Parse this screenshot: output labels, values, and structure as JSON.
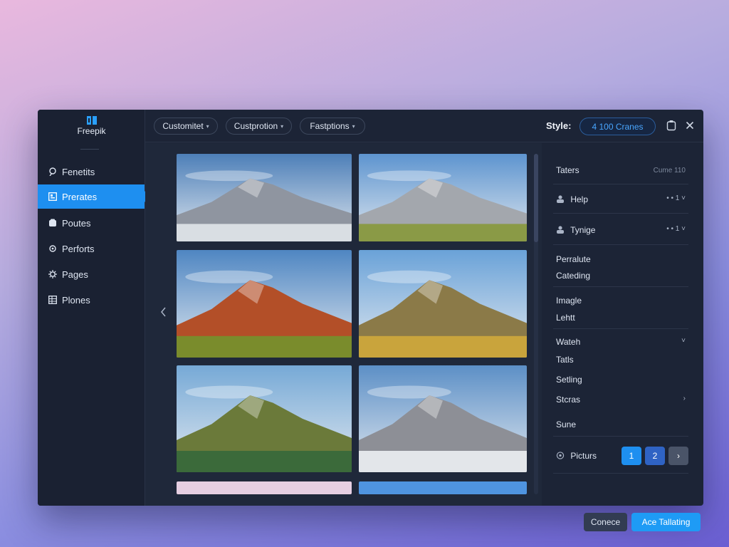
{
  "brand": {
    "name": "Freepik"
  },
  "sidebar": {
    "items": [
      {
        "label": "Fenetits",
        "icon": "search-user-icon"
      },
      {
        "label": "Prerates",
        "icon": "gallery-icon",
        "active": true
      },
      {
        "label": "Poutes",
        "icon": "tag-icon"
      },
      {
        "label": "Perforts",
        "icon": "gear-icon"
      },
      {
        "label": "Pages",
        "icon": "settings-cog-icon"
      },
      {
        "label": "Plones",
        "icon": "grid-table-icon"
      }
    ]
  },
  "toolbar": {
    "filters": [
      "Customitet",
      "Custprotion",
      "Fastptions"
    ],
    "style_label": "Style:",
    "credits": "4 100 Cranes"
  },
  "gallery": {
    "images": [
      {
        "name": "snow-mountain-sunset",
        "sky": "#4d7fb8",
        "rock": "#8f95a0",
        "ground": "#d9dee3"
      },
      {
        "name": "snow-mountain-meadow",
        "sky": "#5d94cf",
        "rock": "#a3a7ad",
        "ground": "#8a9a46"
      },
      {
        "name": "red-rock-hill",
        "sky": "#4f86c2",
        "rock": "#b34f28",
        "ground": "#7a8c2c"
      },
      {
        "name": "mesa-grassland",
        "sky": "#6aa2d8",
        "rock": "#8b7a48",
        "ground": "#c9a43c"
      },
      {
        "name": "green-peak",
        "sky": "#76a9d6",
        "rock": "#6b7a3a",
        "ground": "#3b6a3a"
      },
      {
        "name": "rocky-summit",
        "sky": "#5c8fc6",
        "rock": "#8d8f96",
        "ground": "#e3e6ea"
      }
    ]
  },
  "panel": {
    "header": {
      "title": "Taters",
      "meta": "Cume 110"
    },
    "rows": [
      {
        "label": "Help",
        "value": "• • 1 ˅"
      },
      {
        "label": "Tynige",
        "value": "• • 1 ˅"
      }
    ],
    "groups": [
      {
        "lines": [
          "Perralute",
          "Cateding"
        ]
      },
      {
        "lines": [
          "Imagle",
          "Lehtt"
        ]
      }
    ],
    "list": [
      {
        "label": "Wateh",
        "suffix": "˅"
      },
      {
        "label": "Tatls",
        "suffix": ""
      },
      {
        "label": "Setling",
        "suffix": ""
      },
      {
        "label": "Stcras",
        "suffix": "›"
      },
      {
        "label": "Sune",
        "suffix": ""
      }
    ],
    "pagination": {
      "label": "Picturs",
      "pages": [
        "1",
        "2",
        "›"
      ]
    }
  },
  "footer": {
    "cancel": "Conece",
    "confirm": "Ace Tallating"
  },
  "colors": {
    "accent": "#1e8ff0",
    "window": "#1c2436",
    "sidebar": "#1a2132"
  }
}
